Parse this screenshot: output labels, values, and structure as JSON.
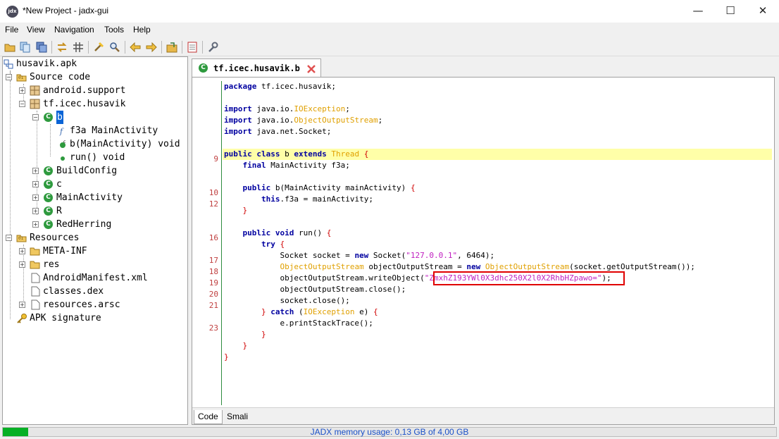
{
  "window": {
    "title": "*New Project - jadx-gui",
    "app_icon_text": "jdx",
    "minimize": "—",
    "maximize": "☐",
    "close": "✕"
  },
  "menu": [
    "File",
    "View",
    "Navigation",
    "Tools",
    "Help"
  ],
  "toolbar": {
    "icons": [
      "open-file-icon",
      "add-files-icon",
      "save-all-icon",
      "sync-with-editor-icon",
      "flatten-packages-icon",
      "decompile-all-icon",
      "search-icon",
      "back-icon",
      "forward-icon",
      "export-icon",
      "log-viewer-icon",
      "preferences-icon"
    ]
  },
  "tree": {
    "root": "husavik.apk",
    "source_code": "Source code",
    "android_support": "android.support",
    "pkg": "tf.icec.husavik",
    "class_b": "b",
    "field_f3a": "f3a MainActivity",
    "ctor": "b(MainActivity) void",
    "run": "run() void",
    "build_config": "BuildConfig",
    "class_c": "c",
    "main_activity": "MainActivity",
    "class_r": "R",
    "red_herring": "RedHerring",
    "resources": "Resources",
    "meta_inf": "META-INF",
    "res": "res",
    "manifest": "AndroidManifest.xml",
    "classes_dex": "classes.dex",
    "resources_arsc": "resources.arsc",
    "apk_signature": "APK signature"
  },
  "editor": {
    "tab_label": "tf.icec.husavik.b",
    "code_tab": "Code",
    "smali_tab": "Smali",
    "highlighted_string": "\"ZmxhZ193YWl0X3dhc250X2l0X2RhbHZpawo=\""
  },
  "code_lines": [
    {
      "ln": "",
      "row": 0
    },
    {
      "ln": "9",
      "row": 6
    },
    {
      "ln": "10",
      "row": 9
    },
    {
      "ln": "12",
      "row": 10
    },
    {
      "ln": "16",
      "row": 13
    },
    {
      "ln": "17",
      "row": 15
    },
    {
      "ln": "18",
      "row": 16
    },
    {
      "ln": "19",
      "row": 17
    },
    {
      "ln": "20",
      "row": 18
    },
    {
      "ln": "21",
      "row": 19
    },
    {
      "ln": "23",
      "row": 21
    }
  ],
  "status": {
    "memory_text": "JADX memory usage: 0,13 GB of 4,00 GB",
    "memory_fraction": 0.0325,
    "fill_color": "#06b025",
    "text_color": "#1a50c8"
  }
}
